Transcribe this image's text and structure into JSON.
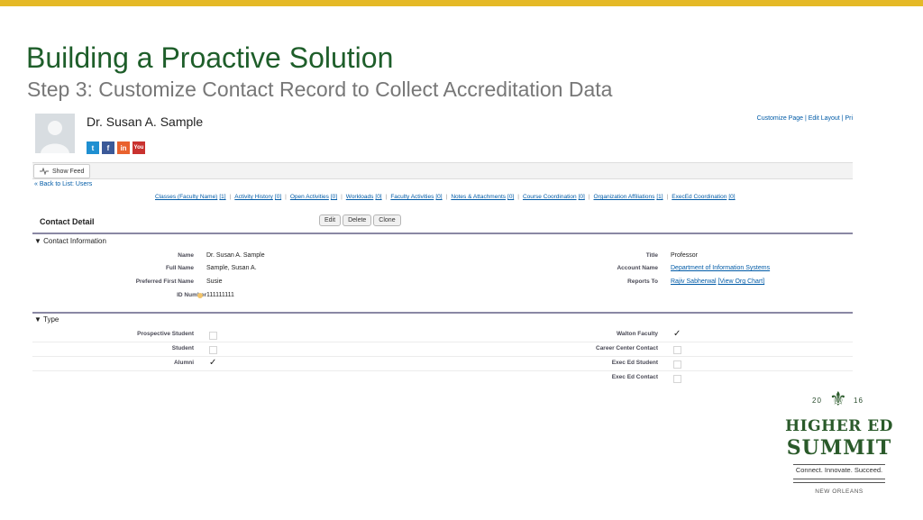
{
  "slide": {
    "title": "Building a Proactive Solution",
    "subtitle": "Step 3:  Customize Contact Record to Collect Accreditation Data"
  },
  "contact": {
    "name": "Dr. Susan A. Sample",
    "top_links": "Customize Page | Edit Layout | Pri",
    "show_feed": "Show Feed",
    "back_link": "« Back to List: Users"
  },
  "related_links": [
    {
      "label": "Classes (Faculty Name)",
      "count": "[1]"
    },
    {
      "label": "Activity History",
      "count": "[0]"
    },
    {
      "label": "Open Activities",
      "count": "[0]"
    },
    {
      "label": "Workloads",
      "count": "[0]"
    },
    {
      "label": "Faculty Activities",
      "count": "[0]"
    },
    {
      "label": "Notes & Attachments",
      "count": "[0]"
    },
    {
      "label": "Course Coordination",
      "count": "[0]"
    },
    {
      "label": "Organization Affiliations",
      "count": "[1]"
    },
    {
      "label": "ExecEd Coordination",
      "count": "[0]"
    }
  ],
  "detail": {
    "title": "Contact Detail",
    "buttons": {
      "edit": "Edit",
      "delete": "Delete",
      "clone": "Clone"
    }
  },
  "contact_info": {
    "header": "▼ Contact Information",
    "left": [
      {
        "label": "Name",
        "value": "Dr. Susan A. Sample"
      },
      {
        "label": "Full Name",
        "value": "Sample, Susan A."
      },
      {
        "label": "Preferred First Name",
        "value": "Susie"
      },
      {
        "label": "ID Number",
        "value": "111111111"
      }
    ],
    "right": [
      {
        "label": "Title",
        "value": "Professor"
      },
      {
        "label": "Account Name",
        "value": "Department of Information Systems"
      },
      {
        "label": "Reports To",
        "value": "Rajiv Sabherwal",
        "extra": "[View Org Chart]"
      }
    ]
  },
  "type_section": {
    "header": "▼ Type",
    "left": [
      {
        "label": "Prospective Student",
        "checked": false
      },
      {
        "label": "Student",
        "checked": false
      },
      {
        "label": "Alumni",
        "checked": true
      }
    ],
    "right": [
      {
        "label": "Walton Faculty",
        "checked": true
      },
      {
        "label": "Career Center Contact",
        "checked": false
      },
      {
        "label": "Exec Ed Student",
        "checked": false
      },
      {
        "label": "Exec Ed Contact",
        "checked": false
      }
    ],
    "check_glyph": "✓"
  },
  "logo": {
    "year_left": "20",
    "year_right": "16",
    "line1": "HIGHER ED",
    "line2": "SUMMIT",
    "tagline": "Connect. Innovate. Succeed.",
    "city": "NEW ORLEANS",
    "color": "#2a5a2a"
  },
  "colors": {
    "accent_bar": "#e5b926",
    "title_green": "#1e5e2a",
    "link_blue": "#015ba7",
    "section_rule": "#8a88a4"
  }
}
